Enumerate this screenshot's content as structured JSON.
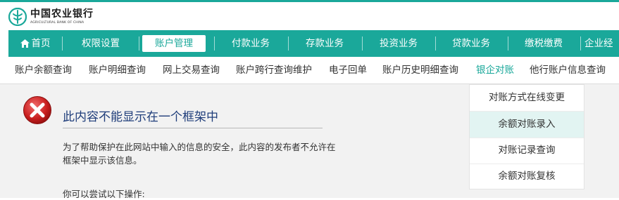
{
  "brand": {
    "name_cn": "中国农业银行",
    "name_en": "AGRICULTURAL BANK OF CHINA",
    "accent": "#1aa89a"
  },
  "nav": {
    "home": "首页",
    "items": [
      "权限设置",
      "账户管理",
      "付款业务",
      "存款业务",
      "投资业务",
      "贷款业务",
      "缴税缴费",
      "企业经"
    ],
    "active_index": 1
  },
  "subnav": {
    "items": [
      "账户余额查询",
      "账户明细查询",
      "网上交易查询",
      "账户跨行查询维护",
      "电子回单",
      "账户历史明细查询",
      "银企对账",
      "他行账户信息查询"
    ],
    "active_index": 6
  },
  "dropdown": {
    "items": [
      "对账方式在线变更",
      "余额对账录入",
      "对账记录查询",
      "余额对账复核"
    ],
    "hover_index": 1
  },
  "error": {
    "title": "此内容不能显示在一个框架中",
    "description": "为了帮助保护在此网站中输入的信息的安全，此内容的发布者不允许在框架中显示该信息。",
    "try_text": "你可以尝试以下操作:"
  }
}
